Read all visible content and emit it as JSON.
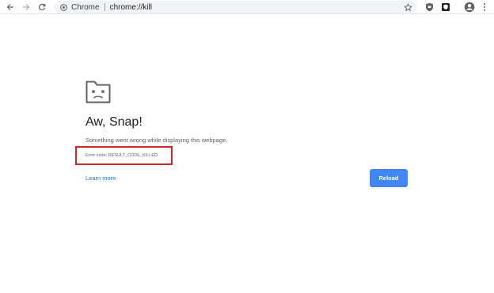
{
  "toolbar": {
    "back_icon": "back-arrow-icon",
    "forward_icon": "forward-arrow-icon",
    "reload_icon": "reload-icon",
    "site_chip": "Chrome",
    "url": "chrome://kill",
    "star_icon": "bookmark-star-icon"
  },
  "page": {
    "icon": "sad-tab-icon",
    "heading": "Aw, Snap!",
    "message": "Something went wrong while displaying this webpage.",
    "error_code": "Error code: RESULT_CODE_KILLED",
    "learn_more": "Learn more",
    "reload_label": "Reload"
  },
  "colors": {
    "accent": "#4285f4",
    "link": "#1a73e8",
    "highlight": "#d0262a"
  }
}
